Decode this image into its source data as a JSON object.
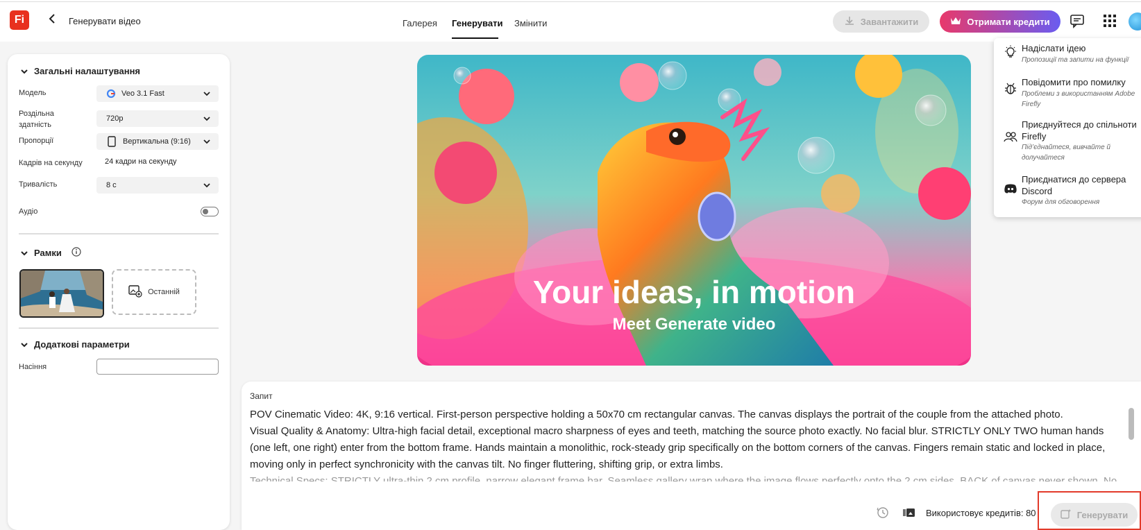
{
  "header": {
    "logo_text": "Fi",
    "title": "Генерувати відео",
    "tabs": [
      "Галерея",
      "Генерувати",
      "Змінити"
    ],
    "active_tab": "Генерувати",
    "download_label": "Завантажити",
    "credits_label": "Отримати кредити"
  },
  "general": {
    "section_title": "Загальні налаштування",
    "model_label": "Модель",
    "model_value": "Veo 3.1 Fast",
    "resolution_label": "Роздільна здатність",
    "resolution_value": "720p",
    "aspect_label": "Пропорції",
    "aspect_value": "Вертикальна (9:16)",
    "fps_label": "Кадрів на секунду",
    "fps_value": "24 кадри на секунду",
    "duration_label": "Тривалість",
    "duration_value": "8 с",
    "audio_label": "Аудіо",
    "audio_on": false
  },
  "frames": {
    "section_title": "Рамки",
    "last_label": "Останній"
  },
  "advanced": {
    "section_title": "Додаткові параметри",
    "seed_label": "Насіння",
    "seed_value": ""
  },
  "hero": {
    "title": "Your ideas, in motion",
    "subtitle": "Meet Generate video"
  },
  "help_menu": [
    {
      "title": "Надіслати ідею",
      "desc": "Пропозиції та запити на функції",
      "icon": "lightbulb-icon"
    },
    {
      "title": "Повідомити про помилку",
      "desc": "Проблеми з використанням Adobe Firefly",
      "icon": "bug-icon"
    },
    {
      "title": "Приєднуйтеся до спільноти Firefly",
      "desc": "Під’єднайтеся, вивчайте й долучайтеся",
      "icon": "community-icon"
    },
    {
      "title": "Приєднатися до сервера Discord",
      "desc": "Форум для обговорення",
      "icon": "discord-icon"
    }
  ],
  "prompt": {
    "label": "Запит",
    "lines": [
      "POV Cinematic Video: 4K, 9:16 vertical. First-person perspective holding a 50x70 cm rectangular canvas. The canvas displays the portrait of the couple from the attached photo.",
      "Visual Quality & Anatomy: Ultra-high facial detail, exceptional macro sharpness of eyes and teeth, matching the source photo exactly. No facial blur. STRICTLY ONLY TWO human hands (one left, one right) enter from the bottom frame. Hands maintain a monolithic, rock-steady grip specifically on the bottom corners of the canvas. Fingers remain static and locked in place, moving only in perfect synchronicity with the canvas tilt. No finger fluttering, shifting grip, or extra limbs.",
      "Technical Specs: STRICTLY ultra-thin 2 cm profile, narrow elegant frame bar. Seamless gallery wrap where the image flows perfectly onto the 2 cm sides. BACK of canvas never shown. No mirror"
    ],
    "credits_text": "Використовує кредитів: 80",
    "generate_label": "Генерувати"
  },
  "colors": {
    "accent_red": "#e8311f",
    "credits_gradient_start": "#e8396b",
    "credits_gradient_end": "#6a5cf0",
    "highlight": "#e23a2a"
  }
}
